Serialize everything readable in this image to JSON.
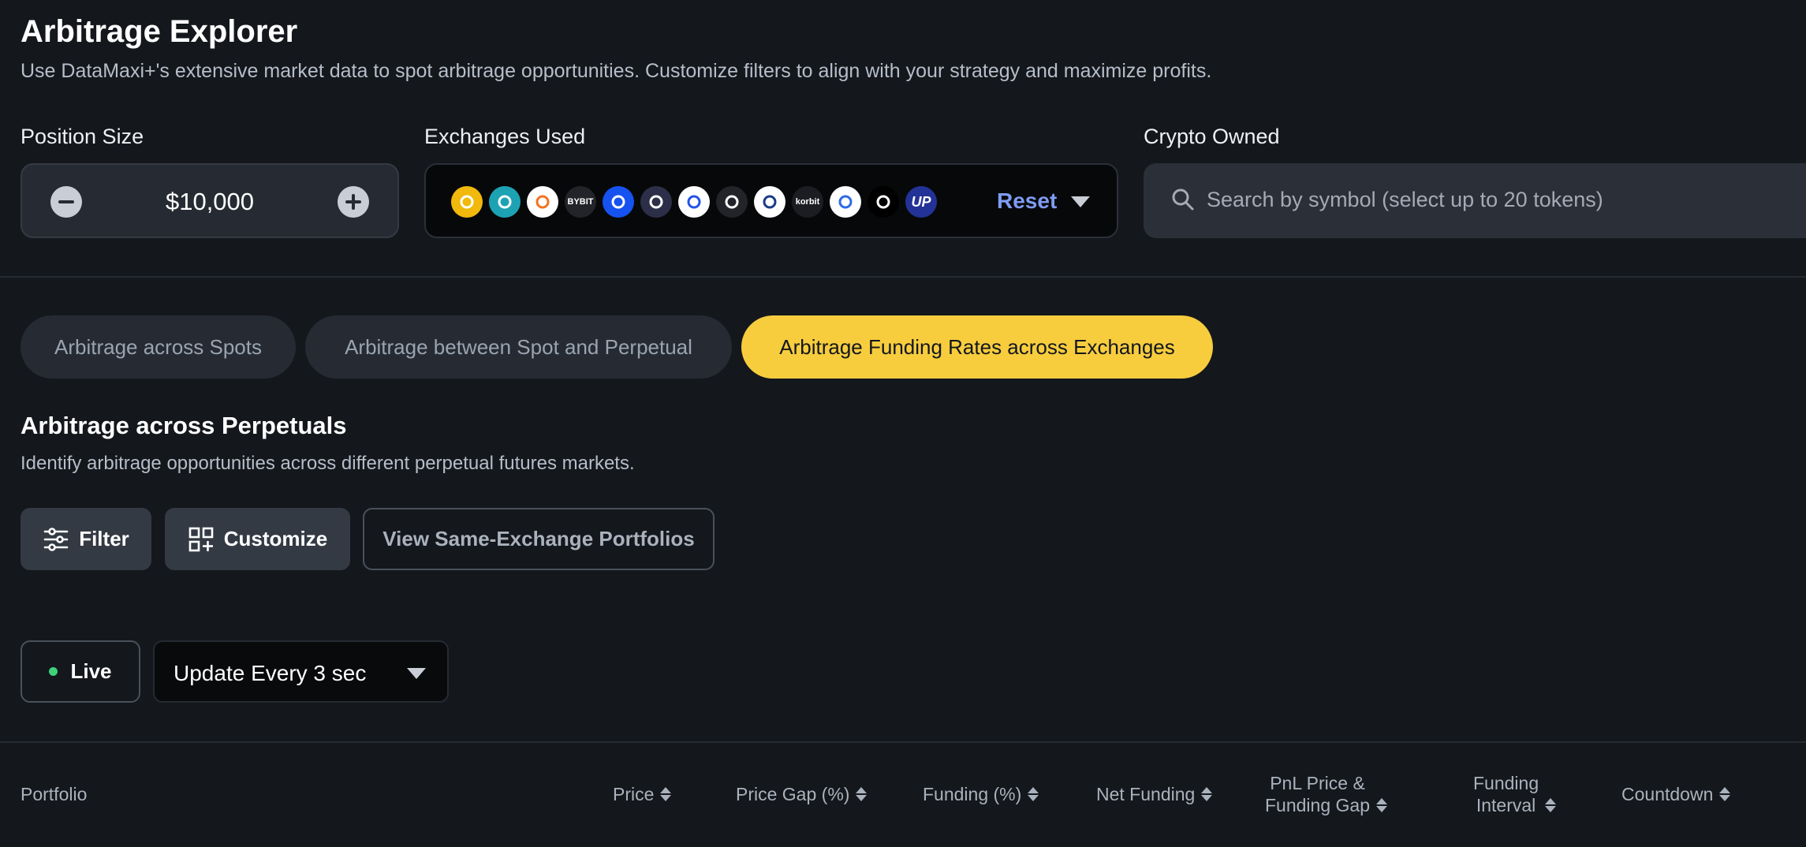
{
  "header": {
    "title": "Arbitrage Explorer",
    "subtitle": "Use DataMaxi+'s extensive market data to spot arbitrage opportunities. Customize filters to align with your strategy and maximize profits."
  },
  "position_size": {
    "label": "Position Size",
    "value": "$10,000"
  },
  "exchanges": {
    "label": "Exchanges Used",
    "reset_label": "Reset",
    "icons": [
      {
        "name": "binance-icon",
        "bg": "#f0b90b",
        "fg": "#ffffff"
      },
      {
        "name": "bitget-icon",
        "bg": "#1da2b4",
        "fg": "#ffffff"
      },
      {
        "name": "bithumb-icon",
        "bg": "#ffffff",
        "fg": "#f37321"
      },
      {
        "name": "bybit-icon",
        "bg": "#222429",
        "fg": "#ffffff",
        "text": "BYBIT"
      },
      {
        "name": "coinbase-icon",
        "bg": "#1652f0",
        "fg": "#ffffff"
      },
      {
        "name": "x-exchange-icon",
        "bg": "#2d2f48",
        "fg": "#ffffff"
      },
      {
        "name": "gateio-icon",
        "bg": "#ffffff",
        "fg": "#2354e6"
      },
      {
        "name": "htx-icon",
        "bg": "#222429",
        "fg": "#ffffff"
      },
      {
        "name": "hyperliquid-icon",
        "bg": "#ffffff",
        "fg": "#1a3a8a"
      },
      {
        "name": "korbit-icon",
        "bg": "#1b1d22",
        "fg": "#ffffff",
        "text": "korbit"
      },
      {
        "name": "mountain-exchange-icon",
        "bg": "#ffffff",
        "fg": "#2c6ae8"
      },
      {
        "name": "okx-icon",
        "bg": "#000000",
        "fg": "#ffffff"
      },
      {
        "name": "upbit-icon",
        "bg": "#233296",
        "fg": "#ffffff",
        "text": "UP"
      }
    ]
  },
  "crypto_owned": {
    "label": "Crypto Owned",
    "placeholder": "Search by symbol (select up to 20 tokens)"
  },
  "tabs": [
    {
      "label": "Arbitrage across Spots"
    },
    {
      "label": "Arbitrage between Spot and Perpetual"
    },
    {
      "label": "Arbitrage Funding Rates across Exchanges"
    }
  ],
  "section": {
    "title": "Arbitrage across Perpetuals",
    "description": "Identify arbitrage opportunities across different perpetual futures markets."
  },
  "actions": {
    "filter_label": "Filter",
    "customize_label": "Customize",
    "view_portfolios_label": "View Same-Exchange Portfolios"
  },
  "live": {
    "live_label": "Live",
    "update_label": "Update Every 3 sec"
  },
  "table": {
    "columns": [
      {
        "label": "Portfolio"
      },
      {
        "label": "Price"
      },
      {
        "label": "Price Gap (%)"
      },
      {
        "label": "Funding (%)"
      },
      {
        "label": "Net Funding"
      },
      {
        "line1": "PnL Price &",
        "line2": "Funding Gap"
      },
      {
        "line1": "Funding",
        "line2": "Interval"
      },
      {
        "label": "Countdown"
      }
    ]
  },
  "colors": {
    "background": "#14171c",
    "accent": "#f7cd3e",
    "link": "#7e9cf4",
    "live": "#3fd27b"
  }
}
